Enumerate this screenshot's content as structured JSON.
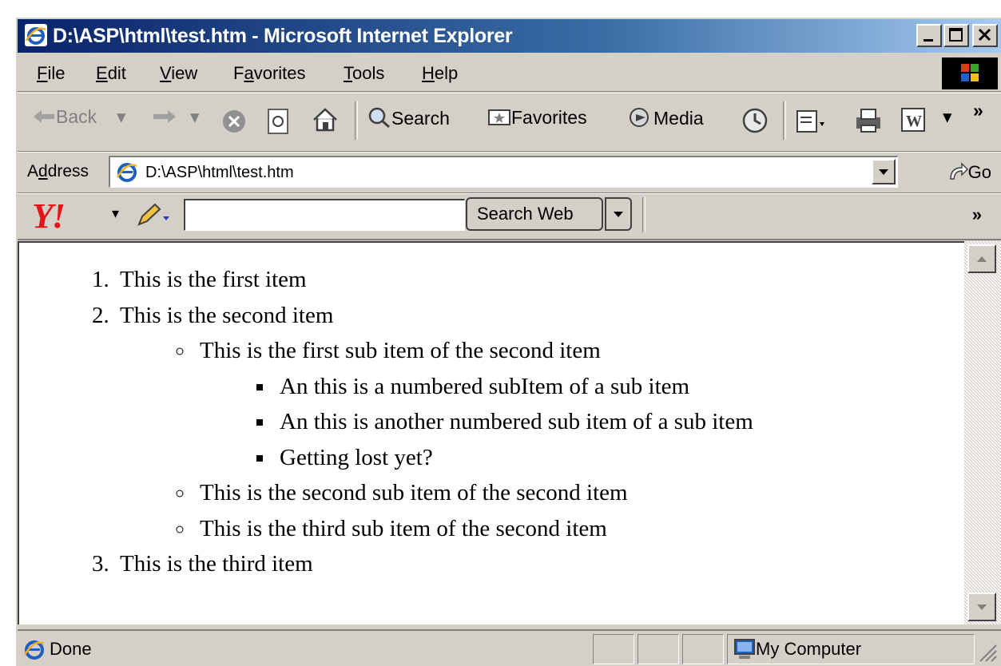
{
  "window": {
    "title": "D:\\ASP\\html\\test.htm - Microsoft Internet Explorer"
  },
  "menu": {
    "items": [
      {
        "pre": "",
        "key": "F",
        "post": "ile"
      },
      {
        "pre": "",
        "key": "E",
        "post": "dit"
      },
      {
        "pre": "",
        "key": "V",
        "post": "iew"
      },
      {
        "pre": "F",
        "key": "a",
        "post": "vorites"
      },
      {
        "pre": "",
        "key": "T",
        "post": "ools"
      },
      {
        "pre": "",
        "key": "H",
        "post": "elp"
      }
    ]
  },
  "toolbar": {
    "back": "Back",
    "search": "Search",
    "favorites": "Favorites",
    "media": "Media",
    "more": "»"
  },
  "address": {
    "label_pre": "A",
    "label_key": "d",
    "label_post": "dress",
    "url": "D:\\ASP\\html\\test.htm",
    "go": "Go"
  },
  "yahoo": {
    "logo": "Y!",
    "search_value": "",
    "search_button": "Search Web",
    "more": "»"
  },
  "document": {
    "item1": "This is the first item",
    "item2": "This is the second item",
    "sub1": "This is the first sub item of the second item",
    "subsub1": "An this is a numbered subItem of a sub item",
    "subsub2": "An this is another numbered sub item of a sub item",
    "subsub3": "Getting lost yet?",
    "sub2": "This is the second sub item of the second item",
    "sub3": "This is the third sub item of the second item",
    "item3": "This is the third item"
  },
  "status": {
    "text": "Done",
    "zone": "My Computer"
  },
  "colors": {
    "title_start": "#0a246a",
    "title_end": "#a6caf0",
    "chrome": "#d4d0c8",
    "yahoo_red": "#e0161b"
  }
}
